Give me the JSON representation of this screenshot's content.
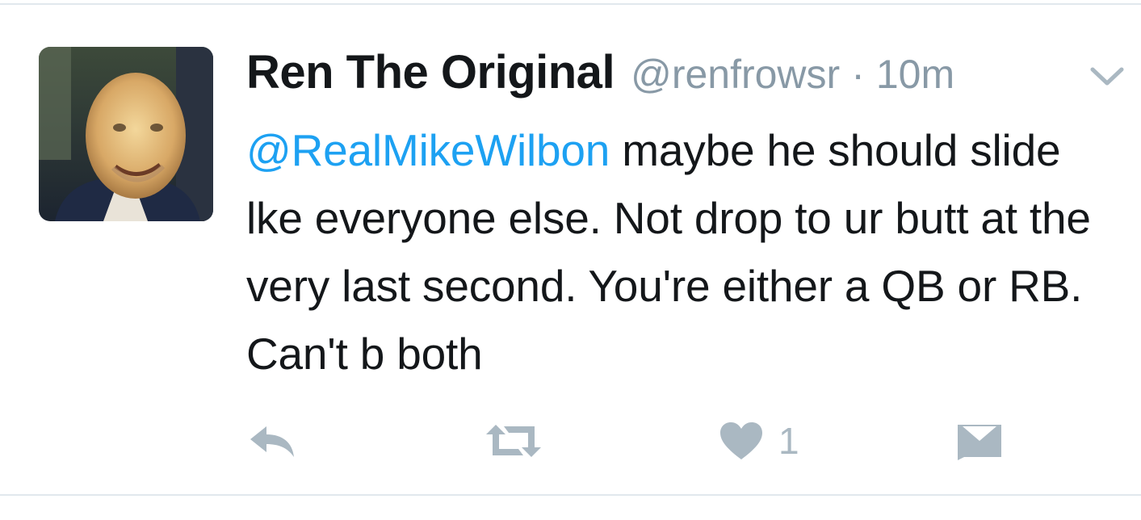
{
  "tweet": {
    "author": {
      "display_name": "Ren The Original",
      "handle": "@renfrowsr"
    },
    "separator": "·",
    "timestamp": "10m",
    "text": {
      "mention": "@RealMikeWilbon",
      "body": " maybe he should slide lke everyone else. Not drop to ur butt at the very last second. You're either a QB or RB. Can't b both"
    },
    "actions": {
      "reply_icon": "reply-icon",
      "retweet_icon": "retweet-icon",
      "like_icon": "heart-icon",
      "like_count": "1",
      "dm_icon": "direct-message-icon"
    },
    "menu_icon": "chevron-down-icon"
  },
  "colors": {
    "text": "#14171a",
    "secondary": "#8899a6",
    "link": "#1da1f2",
    "action_icon": "#aab8c2",
    "divider": "#e1e8ed"
  }
}
